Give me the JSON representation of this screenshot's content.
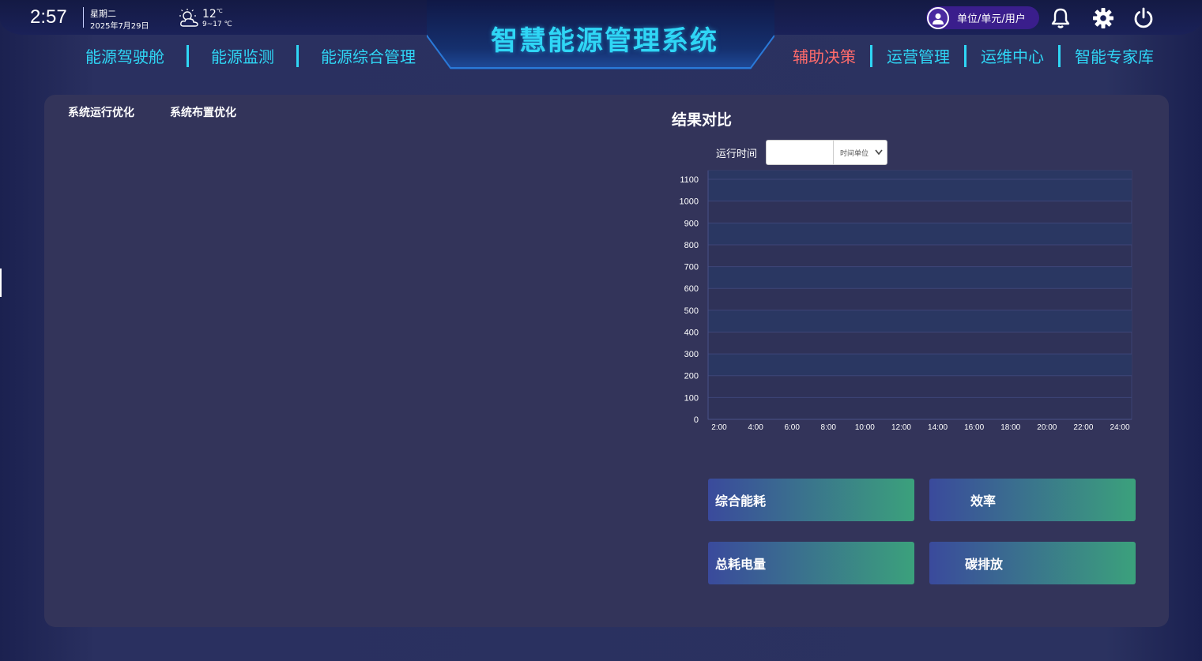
{
  "header": {
    "time": "2:57",
    "weekday": "星期二",
    "date": "2025年7月29日",
    "weather_icon": "partly-cloudy-icon",
    "temperature": "12",
    "temperature_unit": "℃",
    "temperature_range": "9~17 ℃",
    "title": "智慧能源管理系统",
    "user_label": "单位/单元/用户",
    "icons": [
      "user-icon",
      "bell-icon",
      "gear-icon",
      "power-icon"
    ]
  },
  "nav": {
    "left": [
      "能源驾驶舱",
      "能源监测",
      "能源综合管理"
    ],
    "right": [
      "辅助决策",
      "运营管理",
      "运维中心",
      "智能专家库"
    ],
    "active": "辅助决策",
    "active_color": "#ff6b6b",
    "accent_color": "#2fd6f5"
  },
  "panel": {
    "tabs": [
      "系统运行优化",
      "系统布置优化"
    ],
    "result_title": "结果对比",
    "run_time_label": "运行时间",
    "run_time_value": "",
    "time_unit_select": "时间单位",
    "metrics": [
      "综合能耗",
      "效率",
      "总耗电量",
      "碳排放"
    ]
  },
  "chart_data": {
    "type": "bar",
    "categories": [
      "2:00",
      "4:00",
      "6:00",
      "8:00",
      "10:00",
      "12:00",
      "14:00",
      "16:00",
      "18:00",
      "20:00",
      "22:00",
      "24:00"
    ],
    "series": [],
    "ylim": [
      0,
      1100
    ],
    "yticks": [
      0,
      100,
      200,
      300,
      400,
      500,
      600,
      700,
      800,
      900,
      1000,
      1100
    ],
    "grid": true,
    "title": "",
    "xlabel": "",
    "ylabel": ""
  }
}
